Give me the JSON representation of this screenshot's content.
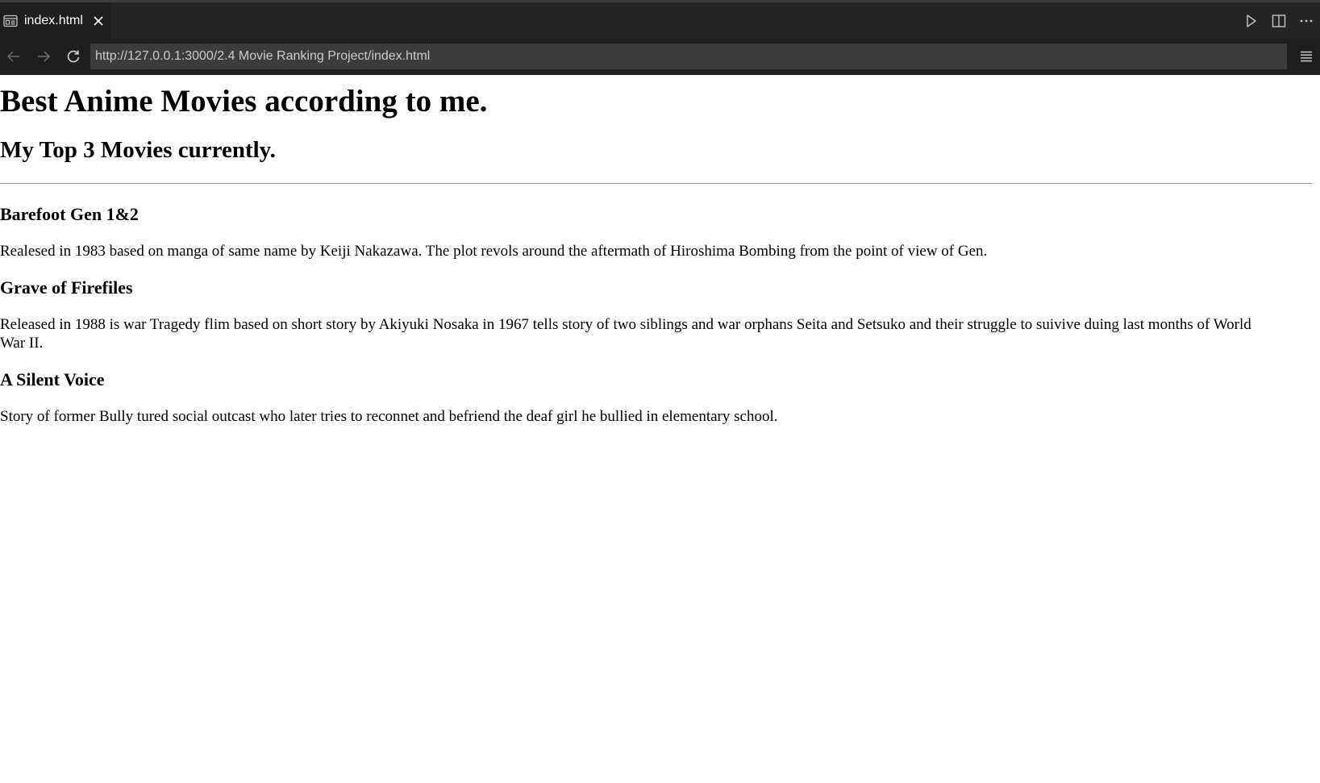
{
  "tab": {
    "title": "index.html",
    "icon": "preview-icon"
  },
  "toolbar": {
    "url": "http://127.0.0.1:3000/2.4 Movie Ranking Project/index.html"
  },
  "page": {
    "heading": "Best Anime Movies according to me.",
    "subheading": "My Top 3 Movies currently.",
    "movies": [
      {
        "title": "Barefoot Gen 1&2",
        "description": "Realesed in 1983 based on manga of same name by Keiji Nakazawa. The plot revols around the aftermath of Hiroshima Bombing from the point of view of Gen."
      },
      {
        "title": "Grave of Firefiles",
        "description": "Released in 1988 is war Tragedy flim based on short story by Akiyuki Nosaka in 1967 tells story of two siblings and war orphans Seita and Setsuko and their struggle to suivive duing last months of World War II."
      },
      {
        "title": "A Silent Voice",
        "description": "Story of former Bully tured social outcast who later tries to reconnet and befriend the deaf girl he bullied in elementary school."
      }
    ]
  },
  "colors": {
    "tabbar_bg": "#252526",
    "toolbar_bg": "#1e1e1e",
    "url_bg": "#3c3c3c",
    "page_bg": "#ffffff"
  }
}
